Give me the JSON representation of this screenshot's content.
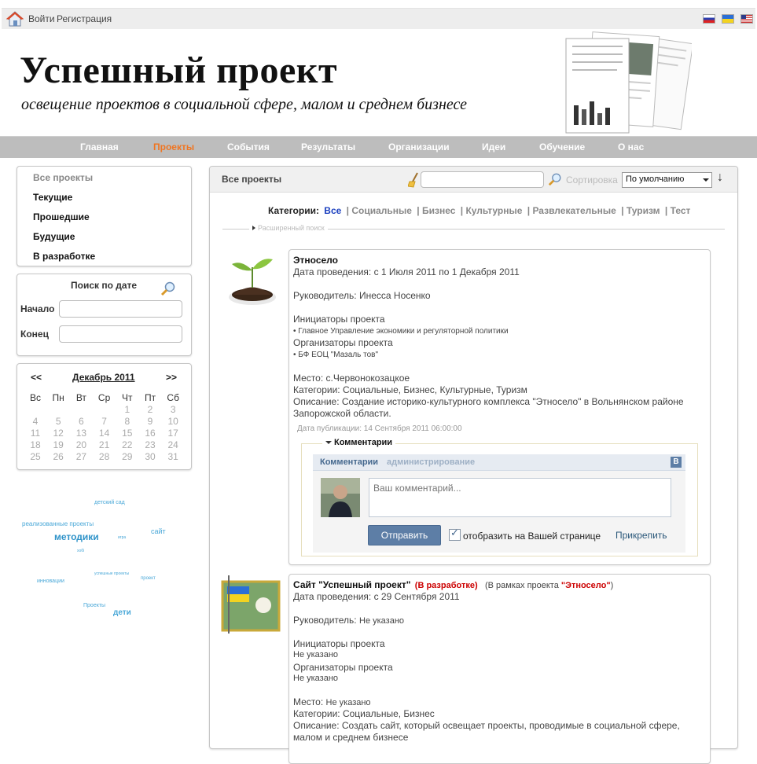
{
  "topbar": {
    "login": "Войти",
    "register": "Регистрация"
  },
  "header": {
    "title": "Успешный проект",
    "subtitle": "освещение проектов в социальной сфере, малом и среднем бизнесе"
  },
  "nav": [
    "Главная",
    "Проекты",
    "События",
    "Результаты",
    "Организации",
    "Идеи",
    "Обучение",
    "О нас"
  ],
  "projects_menu": [
    "Все проекты",
    "Текущие",
    "Прошедшие",
    "Будущие",
    "В разработке"
  ],
  "date_search": {
    "title": "Поиск по дате",
    "start": "Начало",
    "end": "Конец"
  },
  "calendar": {
    "prev": "<<",
    "next": ">>",
    "month": "Декабрь 2011",
    "dow": [
      "Вс",
      "Пн",
      "Вт",
      "Ср",
      "Чт",
      "Пт",
      "Сб"
    ],
    "days": [
      "",
      "",
      "",
      "",
      "1",
      "2",
      "3",
      "4",
      "5",
      "6",
      "7",
      "8",
      "9",
      "10",
      "11",
      "12",
      "13",
      "14",
      "15",
      "16",
      "17",
      "18",
      "19",
      "20",
      "21",
      "22",
      "23",
      "24",
      "25",
      "26",
      "27",
      "28",
      "29",
      "30",
      "31"
    ]
  },
  "tags": [
    "детский сад",
    "реализованные проекты",
    "методики",
    "сайт",
    "игра",
    "хобі",
    "инновации",
    "успешные проекты",
    "проект",
    "Проекты",
    "дети"
  ],
  "main": {
    "heading": "Все проекты",
    "sort_label": "Сортировка",
    "sort_value": "По умолчанию",
    "categories_label": "Категории:",
    "categories": [
      "Все",
      "| Социальные",
      "| Бизнес",
      "| Культурные",
      "| Развлекательные",
      "| Туризм",
      "| Тест"
    ],
    "advanced_search": "Расширенный поиск"
  },
  "project1": {
    "title": "Этносело",
    "dates": "Дата проведения: с 1 Июля 2011 по 1 Декабря 2011",
    "leader": "Руководитель: Инесса Носенко",
    "initiators_h": "Инициаторы проекта",
    "initiators": "• Главное Управление экономики и регуляторной политики",
    "organizers_h": "Организаторы проекта",
    "organizers": "• БФ ЕОЦ \"Мазаль тов\"",
    "place": "Место: с.Червонокозацкое",
    "categories": "Категории: Социальные, Бизнес, Культурные, Туризм",
    "desc1": "Описание: Создание историко-культурного комплекса \"Этносело\" в Вольнянском районе",
    "desc2": "Запорожской области.",
    "published": "Дата публикации: 14 Сентября 2011 06:00:00"
  },
  "comments": {
    "legend": "Комментарии",
    "title": "Комментарии",
    "admin": "администрирование",
    "vk": "B",
    "placeholder": "Ваш комментарий...",
    "send": "Отправить",
    "show_on_page": "отобразить на Вашей странице",
    "attach": "Прикрепить"
  },
  "project2": {
    "title": "Сайт \"Успешный проект\"",
    "status": "(В разработке)",
    "context_pre": "(В рамках проекта ",
    "context_link": "\"Этносело\"",
    "context_post": ")",
    "dates": "Дата проведения: с 29 Сентября 2011",
    "leader_label": "Руководитель:",
    "leader_value": "Не указано",
    "initiators_h": "Инициаторы проекта",
    "initiators": "Не указано",
    "organizers_h": "Организаторы проекта",
    "organizers": "Не указано",
    "place_label": "Место:",
    "place_value": "Не указано",
    "categories": "Категории: Социальные, Бизнес",
    "desc1": "Описание: Создать сайт, который освещает проекты, проводимые в социальной сфере,",
    "desc2": "малом и среднем бизнесе"
  },
  "colors": {
    "nav_bg": "#bdbdbd",
    "nav_active": "#f07521",
    "link_blue": "#1a3fbf",
    "vk_bar": "#e6ebf2",
    "vk_button": "#5d7ea6",
    "status_red": "#cc0000"
  }
}
